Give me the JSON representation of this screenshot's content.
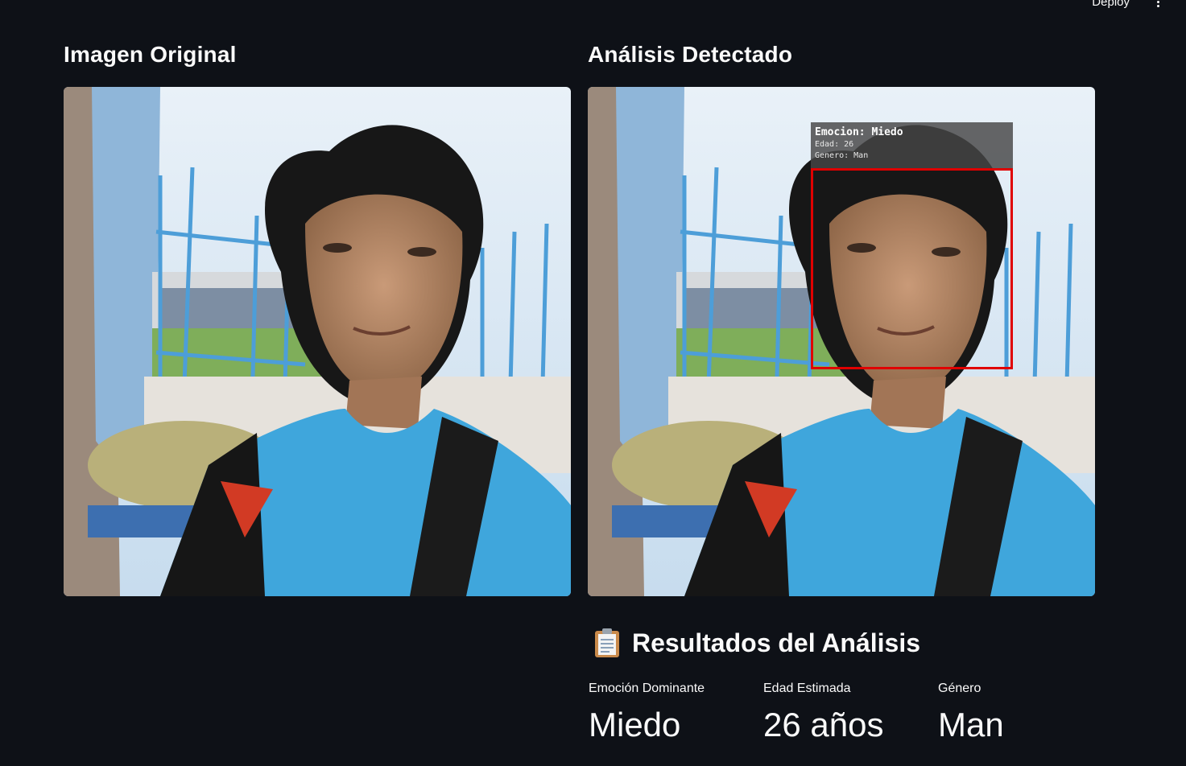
{
  "header": {
    "deploy_label": "Deploy",
    "menu_icon": "kebab-vertical-icon"
  },
  "left_column": {
    "title": "Imagen Original"
  },
  "right_column": {
    "title": "Análisis Detectado",
    "overlay": {
      "line1": "Emocion: Miedo",
      "line2": "Edad: 26",
      "line3": "Genero: Man",
      "box_color": "#e00000"
    }
  },
  "results": {
    "icon": "clipboard-icon",
    "title": "Resultados del Análisis",
    "metrics": [
      {
        "label": "Emoción Dominante",
        "value": "Miedo"
      },
      {
        "label": "Edad Estimada",
        "value": "26 años"
      },
      {
        "label": "Género",
        "value": "Man"
      }
    ]
  },
  "colors": {
    "background": "#0e1117",
    "text": "#fafafa"
  }
}
